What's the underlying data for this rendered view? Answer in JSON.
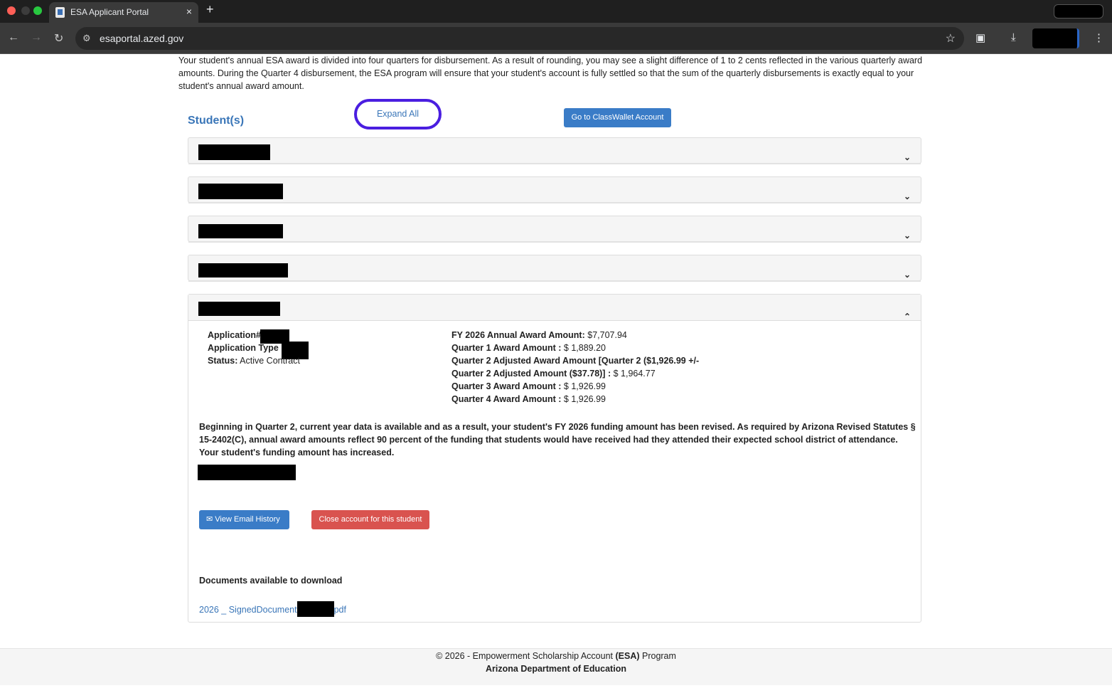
{
  "browser": {
    "tab_title": "ESA Applicant Portal",
    "tab_close": "×",
    "new_tab": "+",
    "url": "esaportal.azed.gov"
  },
  "intro_text": "Your student's annual ESA award is divided into four quarters for disbursement. As a result of rounding, you may see a slight difference of 1 to 2 cents reflected in the various quarterly award amounts. During the Quarter 4 disbursement, the ESA program will ensure that your student's account is fully settled so that the sum of the quarterly disbursements is exactly equal to your student's annual award amount.",
  "students_title": "Student(s)",
  "expand_all_label": "Expand All",
  "classwallet_label": "Go to ClassWallet Account",
  "student": {
    "application_label": "Application#",
    "application_type_label": "Application Type",
    "status_label": "Status:",
    "status_value": "Active Contract",
    "fy_label": "FY 2026 Annual Award Amount:",
    "fy_value": "$7,707.94",
    "q1_label": "Quarter 1 Award Amount :",
    "q1_value": "$ 1,889.20",
    "q2_label_line1": "Quarter 2 Adjusted Award Amount [Quarter 2 ($1,926.99 +/-",
    "q2_label_line2": "Quarter 2 Adjusted Amount ($37.78)] :",
    "q2_value": "$ 1,964.77",
    "q3_label": "Quarter 3 Award Amount :",
    "q3_value": "$ 1,926.99",
    "q4_label": "Quarter 4 Award Amount :",
    "q4_value": "$ 1,926.99",
    "notice": "Beginning in Quarter 2, current year data is available and as a result, your student's FY 2026 funding amount has been revised. As required by Arizona Revised Statutes § 15-2402(C), annual award amounts reflect 90 percent of the funding that students would have received had they attended their expected school district of attendance. Your student's funding amount has increased.",
    "email_history_label": "View Email History",
    "close_account_label": "Close account for this student",
    "docs_title": "Documents available to download",
    "doc_link_prefix": "2026 _ SignedDocument",
    "doc_link_suffix": "pdf"
  },
  "footer": {
    "line1_prefix": "© 2026 - Empowerment Scholarship Account ",
    "line1_bold": "(ESA)",
    "line1_suffix": " Program",
    "line2": "Arizona Department of Education"
  },
  "icons": {
    "chevron_down": "⌄",
    "chevron_up": "⌃",
    "envelope": "✉"
  }
}
